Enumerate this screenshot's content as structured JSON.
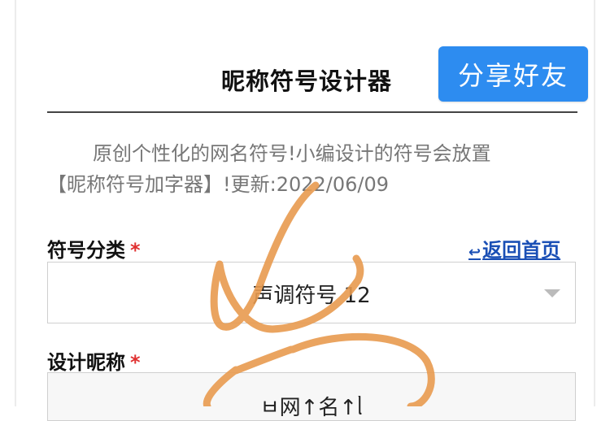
{
  "header": {
    "title": "昵称符号设计器",
    "share_label": "分享好友"
  },
  "intro": {
    "line1": "原创个性化的网名符号!小编设计的符号会放置",
    "line2": "【昵称符号加字器】!更新:2022/06/09"
  },
  "form": {
    "category_label": "符号分类",
    "required_mark": "*",
    "back_home_label": "返回首页",
    "back_icon": "↩",
    "category_value": "声调符号 12",
    "nickname_label": "设计昵称",
    "nickname_value": "ㅂ网↑名↑ᥣ"
  },
  "colors": {
    "accent": "#2d8cf0",
    "required": "#e03131",
    "link": "#1a4fb5",
    "scribble": "#e89a4f"
  }
}
